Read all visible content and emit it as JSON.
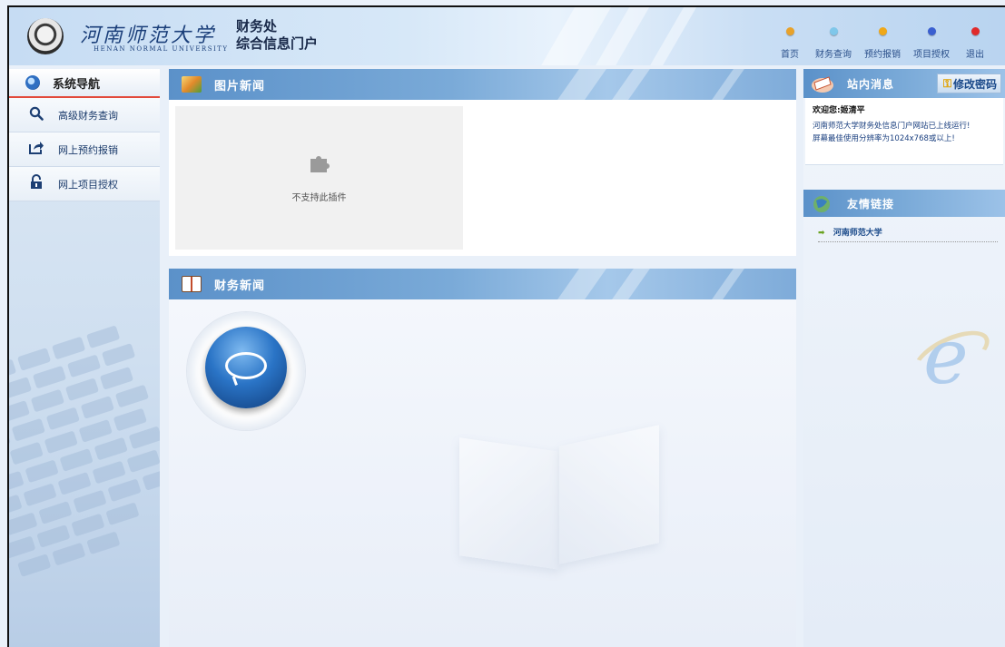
{
  "header": {
    "university_cn": "河南师范大学",
    "university_en": "HENAN NORMAL UNIVERSITY",
    "dept_line1": "财务处",
    "dept_line2": "综合信息门户",
    "nav": [
      {
        "label": "首页",
        "dot_color": "#e8a22a"
      },
      {
        "label": "财务查询",
        "dot_color": "#7fc7ea"
      },
      {
        "label": "预约报销",
        "dot_color": "#f0a818"
      },
      {
        "label": "项目授权",
        "dot_color": "#3a5fd0"
      },
      {
        "label": "退出",
        "dot_color": "#e02a2a"
      }
    ]
  },
  "sidebar": {
    "heading": "系统导航",
    "items": [
      {
        "label": "高级财务查询",
        "icon": "search-icon"
      },
      {
        "label": "网上预约报销",
        "icon": "share-icon"
      },
      {
        "label": "网上项目授权",
        "icon": "lock-icon"
      }
    ]
  },
  "picture_news": {
    "title": "图片新闻",
    "plugin_message": "不支持此插件"
  },
  "finance_news": {
    "title": "财务新闻"
  },
  "messages": {
    "title": "站内消息",
    "change_password_label": "修改密码",
    "welcome": "欢迎您:姬清平",
    "line1": "河南师范大学财务处信息门户网站已上线运行!",
    "line2": "屏幕最佳使用分辨率为1024x768或以上!"
  },
  "links": {
    "title": "友情链接",
    "items": [
      {
        "label": "河南师范大学"
      }
    ]
  },
  "colors": {
    "accent_blue": "#5b91c9",
    "nav_underline": "#e24a3c",
    "link_arrow": "#6aa321"
  }
}
